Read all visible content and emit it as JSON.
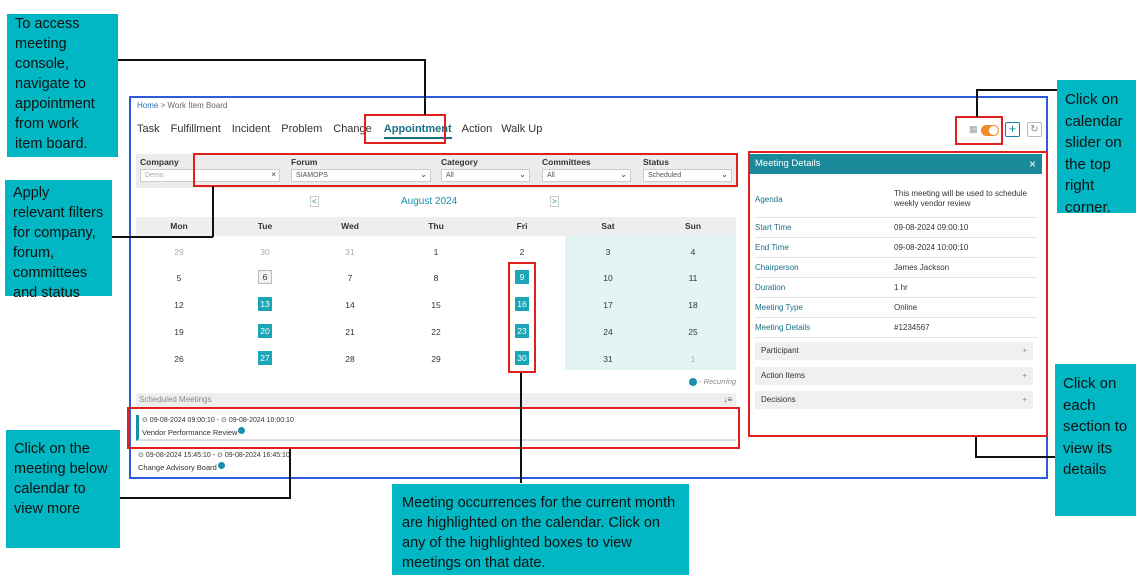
{
  "breadcrumb": {
    "home": "Home",
    "separator": ">",
    "current": "Work Item Board"
  },
  "nav": {
    "tabs": [
      {
        "label": "Task"
      },
      {
        "label": "Fulfillment"
      },
      {
        "label": "Incident"
      },
      {
        "label": "Problem"
      },
      {
        "label": "Change"
      },
      {
        "label": "Appointment"
      },
      {
        "label": "Action"
      },
      {
        "label": "Walk Up"
      }
    ],
    "active": "Appointment"
  },
  "toolbar": {
    "calendar_icon": "calendar-icon",
    "toggle_state": "on",
    "add_label": "+",
    "refresh_icon": "refresh-icon"
  },
  "filters": {
    "company": {
      "label": "Company",
      "placeholder": "Demo",
      "clear": "×"
    },
    "forum": {
      "label": "Forum",
      "value": "SIAMOPS"
    },
    "category": {
      "label": "Category",
      "value": "All"
    },
    "committees": {
      "label": "Committees",
      "value": "All"
    },
    "status": {
      "label": "Status",
      "value": "Scheduled"
    }
  },
  "calendar": {
    "month_label": "August 2024",
    "prev": "<",
    "next": ">",
    "weekdays": [
      "Mon",
      "Tue",
      "Wed",
      "Thu",
      "Fri",
      "Sat",
      "Sun"
    ],
    "weeks": [
      [
        "29",
        "30",
        "31",
        "1",
        "2",
        "3",
        "4"
      ],
      [
        "5",
        "6",
        "7",
        "8",
        "9",
        "10",
        "11"
      ],
      [
        "12",
        "13",
        "14",
        "15",
        "16",
        "17",
        "18"
      ],
      [
        "19",
        "20",
        "21",
        "22",
        "23",
        "24",
        "25"
      ],
      [
        "26",
        "27",
        "28",
        "29",
        "30",
        "31",
        "1"
      ]
    ],
    "legend": "- Recurring"
  },
  "scheduled": {
    "header": "Scheduled Meetings",
    "sort_icon": "↓≡",
    "meetings": [
      {
        "time": "⊙ 09-08-2024 09:00:10 - ⊙ 09-08-2024 10:00:10",
        "title": "Vendor Performance Review"
      },
      {
        "time": "⊙ 09-08-2024 15:45:10 - ⊙ 09-08-2024 16:45:10",
        "title": "Change Advisory Board"
      }
    ]
  },
  "details": {
    "title": "Meeting Details",
    "close": "×",
    "rows": [
      {
        "key": "Agenda",
        "value": "This meeting will be used to schedule weekly vendor review"
      },
      {
        "key": "Start Time",
        "value": "09-08-2024 09:00:10"
      },
      {
        "key": "End Time",
        "value": "09-08-2024 10:00:10"
      },
      {
        "key": "Chairperson",
        "value": "James Jackson"
      },
      {
        "key": "Duration",
        "value": "1 hr"
      },
      {
        "key": "Meeting Type",
        "value": "Online"
      },
      {
        "key": "Meeting Details",
        "value": "#1234567"
      }
    ],
    "sections": [
      {
        "label": "Participant",
        "icon": "+"
      },
      {
        "label": "Action Items",
        "icon": "+"
      },
      {
        "label": "Decisions",
        "icon": "+"
      }
    ]
  },
  "callouts": {
    "c1": "To access meeting console, navigate to appointment from work item board.",
    "c2": "Apply relevant filters for company, forum, committees and status",
    "c3": "Click on the meeting below calendar to view more",
    "c4": "Meeting occurrences for the current month are highlighted on the calendar. Click on any of the highlighted boxes to view meetings on that date.",
    "c5": "Click on calendar slider on the top right corner.",
    "c6": "Click on each section to view its details"
  },
  "colors": {
    "accent": "#1a8a9a",
    "highlight": "#1aa6b7",
    "callout": "#00b7c3",
    "annotation": "#e0201f",
    "frame": "#2e5bd9",
    "toggle": "#f28a2c"
  }
}
